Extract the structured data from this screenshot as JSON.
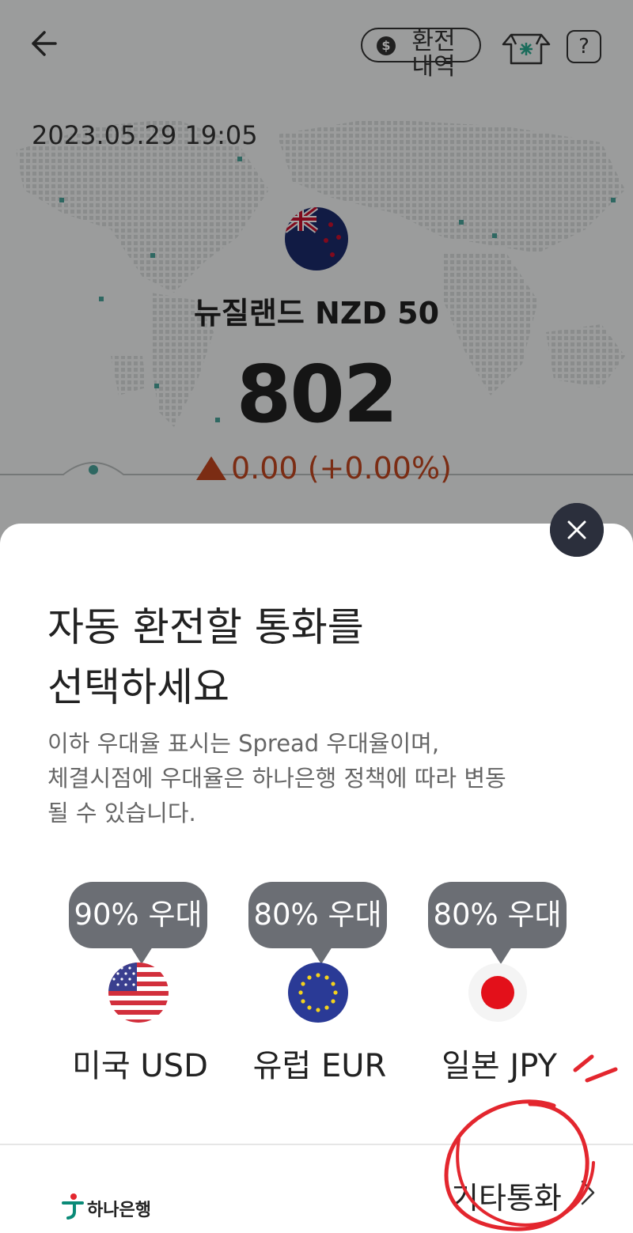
{
  "header": {
    "back_icon": "arrow-left-icon",
    "history_label": "환전\n내역",
    "history_icon": "dollar-coin-icon",
    "shop_icon": "store-icon",
    "help_label": "?"
  },
  "timestamp": "2023.05.29 19:05",
  "rate": {
    "flag": "nz-flag-icon",
    "name": "뉴질랜드 NZD 50",
    "value": "802",
    "change_text": "0.00 (+0.00%)",
    "change_color": "#c1451e"
  },
  "sheet": {
    "title": "자동 환전할 통화를\n선택하세요",
    "description": "이하 우대율 표시는 Spread 우대율이며,\n체결시점에 우대율은 하나은행 정책에 따라 변동\n될 수 있습니다.",
    "currencies": [
      {
        "badge": "90% 우대",
        "label": "미국 USD",
        "flag": "us-flag-icon"
      },
      {
        "badge": "80% 우대",
        "label": "유럽 EUR",
        "flag": "eu-flag-icon"
      },
      {
        "badge": "80% 우대",
        "label": "일본 JPY",
        "flag": "jp-flag-icon"
      }
    ],
    "footer": {
      "bank_name": "하나은행",
      "other_label": "기타통화"
    },
    "close_icon": "close-icon"
  },
  "colors": {
    "accent_dark": "#2b2f3c",
    "badge_bg": "#6b6e74",
    "annotation_red": "#e3262e"
  }
}
